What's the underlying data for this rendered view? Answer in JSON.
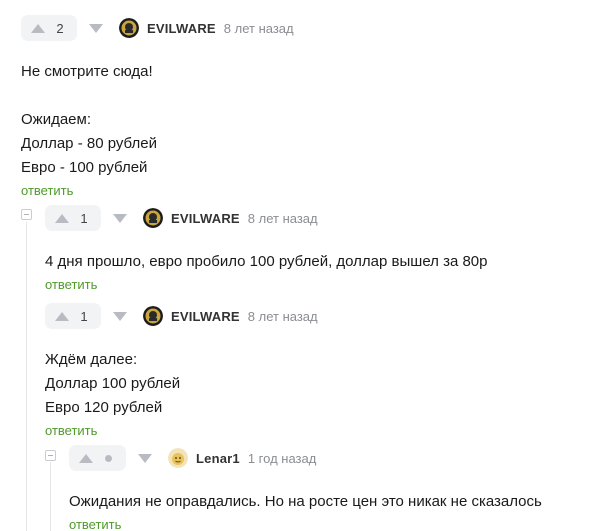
{
  "comments": [
    {
      "rating": "2",
      "author": "EVILWARE",
      "time": "8 лет назад",
      "lines": [
        "Не смотрите сюда!",
        "",
        "Ожидаем:",
        "Доллар - 80 рублей",
        "Евро - 100 рублей"
      ],
      "reply_label": "ответить"
    },
    {
      "rating": "1",
      "author": "EVILWARE",
      "time": "8 лет назад",
      "lines": [
        "4 дня прошло, евро пробило 100 рублей, доллар вышел за 80р"
      ],
      "reply_label": "ответить"
    },
    {
      "rating": "1",
      "author": "EVILWARE",
      "time": "8 лет назад",
      "lines": [
        "Ждём далее:",
        "Доллар 100 рублей",
        "Евро 120 рублей"
      ],
      "reply_label": "ответить"
    },
    {
      "rating": "",
      "author": "Lenar1",
      "time": "1 год назад",
      "lines": [
        "Ожидания не оправдались. Но на росте цен это никак не сказалось"
      ],
      "reply_label": "ответить"
    }
  ],
  "colors": {
    "reply": "#4e9b2a",
    "vote_bg": "#f2f3f5",
    "icon": "#b8bcc2"
  },
  "icons": {
    "upvote": "triangle-up-icon",
    "downvote": "triangle-down-icon",
    "collapse": "collapse-minus-icon",
    "neutral": "dot-icon"
  }
}
